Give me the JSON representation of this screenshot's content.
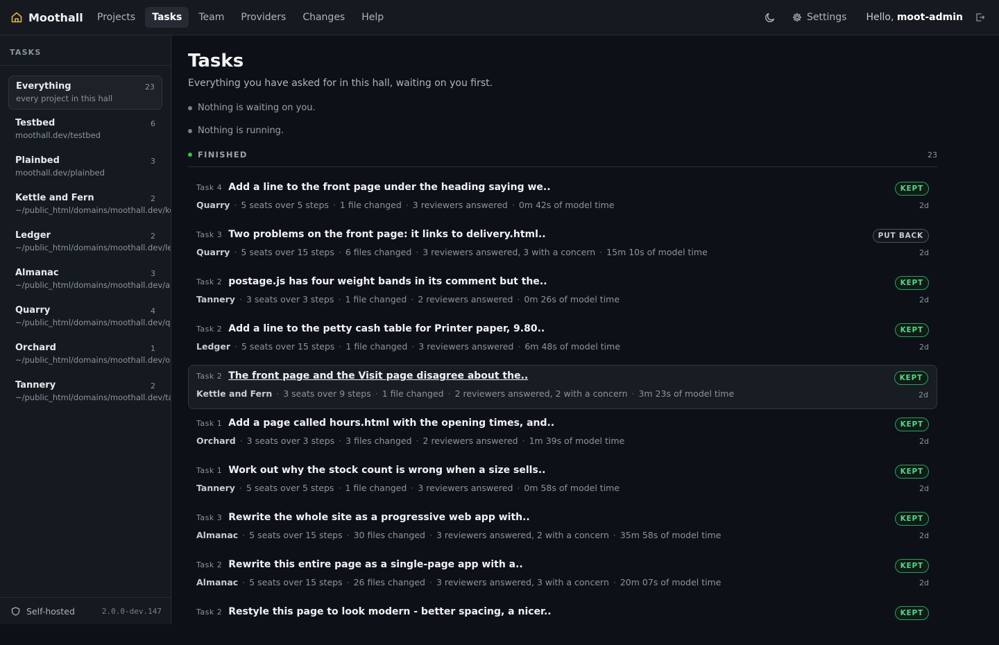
{
  "app": {
    "name": "Moothall",
    "nav": [
      {
        "label": "Projects",
        "active": false
      },
      {
        "label": "Tasks",
        "active": true
      },
      {
        "label": "Team",
        "active": false
      },
      {
        "label": "Providers",
        "active": false
      },
      {
        "label": "Changes",
        "active": false
      },
      {
        "label": "Help",
        "active": false
      }
    ],
    "settings_label": "Settings",
    "greeting": "Hello,",
    "username": "moot-admin"
  },
  "sidebar": {
    "heading": "TASKS",
    "projects": [
      {
        "name": "Everything",
        "path": "every project in this hall",
        "count": "23",
        "active": true
      },
      {
        "name": "Testbed",
        "path": "moothall.dev/testbed",
        "count": "6"
      },
      {
        "name": "Plainbed",
        "path": "moothall.dev/plainbed",
        "count": "3"
      },
      {
        "name": "Kettle and Fern",
        "path": "~/public_html/domains/moothall.dev/kettle-and-fern",
        "count": "2"
      },
      {
        "name": "Ledger",
        "path": "~/public_html/domains/moothall.dev/ledger",
        "count": "2"
      },
      {
        "name": "Almanac",
        "path": "~/public_html/domains/moothall.dev/almanac",
        "count": "3"
      },
      {
        "name": "Quarry",
        "path": "~/public_html/domains/moothall.dev/quarry",
        "count": "4"
      },
      {
        "name": "Orchard",
        "path": "~/public_html/domains/moothall.dev/orchard",
        "count": "1"
      },
      {
        "name": "Tannery",
        "path": "~/public_html/domains/moothall.dev/tannery",
        "count": "2"
      }
    ],
    "footer_label": "Self-hosted",
    "version": "2.0.0-dev.147"
  },
  "main": {
    "title": "Tasks",
    "subtitle": "Everything you have asked for in this hall, waiting on you first.",
    "waiting_text": "Nothing is waiting on you.",
    "running_text": "Nothing is running.",
    "finished_label": "FINISHED",
    "finished_count": "23",
    "tasks": [
      {
        "num": "Task 4",
        "title": "Add a line to the front page under the heading saying we..",
        "project": "Quarry",
        "meta": [
          "5 seats over 5 steps",
          "1 file changed",
          "3 reviewers answered",
          "0m 42s of model time"
        ],
        "badge": "KEPT",
        "badge_kind": "kept",
        "age": "2d"
      },
      {
        "num": "Task 3",
        "title": "Two problems on the front page: it links to delivery.html..",
        "project": "Quarry",
        "meta": [
          "5 seats over 15 steps",
          "6 files changed",
          "3 reviewers answered, 3 with a concern",
          "15m 10s of model time"
        ],
        "badge": "PUT BACK",
        "badge_kind": "back",
        "age": "2d"
      },
      {
        "num": "Task 2",
        "title": "postage.js has four weight bands in its comment but the..",
        "project": "Tannery",
        "meta": [
          "3 seats over 3 steps",
          "1 file changed",
          "2 reviewers answered",
          "0m 26s of model time"
        ],
        "badge": "KEPT",
        "badge_kind": "kept",
        "age": "2d"
      },
      {
        "num": "Task 2",
        "title": "Add a line to the petty cash table for Printer paper, 9.80..",
        "project": "Ledger",
        "meta": [
          "5 seats over 15 steps",
          "1 file changed",
          "3 reviewers answered",
          "6m 48s of model time"
        ],
        "badge": "KEPT",
        "badge_kind": "kept",
        "age": "2d"
      },
      {
        "num": "Task 2",
        "title": "The front page and the Visit page disagree about the..",
        "project": "Kettle and Fern",
        "meta": [
          "3 seats over 9 steps",
          "1 file changed",
          "2 reviewers answered, 2 with a concern",
          "3m 23s of model time"
        ],
        "badge": "KEPT",
        "badge_kind": "kept",
        "age": "2d",
        "hover": true
      },
      {
        "num": "Task 1",
        "title": "Add a page called hours.html with the opening times, and..",
        "project": "Orchard",
        "meta": [
          "3 seats over 3 steps",
          "3 files changed",
          "2 reviewers answered",
          "1m 39s of model time"
        ],
        "badge": "KEPT",
        "badge_kind": "kept",
        "age": "2d"
      },
      {
        "num": "Task 1",
        "title": "Work out why the stock count is wrong when a size sells..",
        "project": "Tannery",
        "meta": [
          "5 seats over 5 steps",
          "1 file changed",
          "3 reviewers answered",
          "0m 58s of model time"
        ],
        "badge": "KEPT",
        "badge_kind": "kept",
        "age": "2d"
      },
      {
        "num": "Task 3",
        "title": "Rewrite the whole site as a progressive web app with..",
        "project": "Almanac",
        "meta": [
          "5 seats over 15 steps",
          "30 files changed",
          "3 reviewers answered, 2 with a concern",
          "35m 58s of model time"
        ],
        "badge": "KEPT",
        "badge_kind": "kept",
        "age": "2d"
      },
      {
        "num": "Task 2",
        "title": "Rewrite this entire page as a single-page app with a..",
        "project": "Almanac",
        "meta": [
          "5 seats over 15 steps",
          "26 files changed",
          "3 reviewers answered, 3 with a concern",
          "20m 07s of model time"
        ],
        "badge": "KEPT",
        "badge_kind": "kept",
        "age": "2d"
      },
      {
        "num": "Task 2",
        "title": "Restyle this page to look modern - better spacing, a nicer..",
        "project": "",
        "meta": [],
        "badge": "KEPT",
        "badge_kind": "kept",
        "age": ""
      }
    ]
  },
  "colors": {
    "background": "#0d1117",
    "panel": "#151920",
    "kept": "#56d38a",
    "finished_dot": "#3fb950"
  },
  "icons": {
    "brand": "home-icon",
    "theme": "moon-icon",
    "settings": "gear-icon",
    "logout": "logout-icon",
    "footer": "shield-icon"
  }
}
